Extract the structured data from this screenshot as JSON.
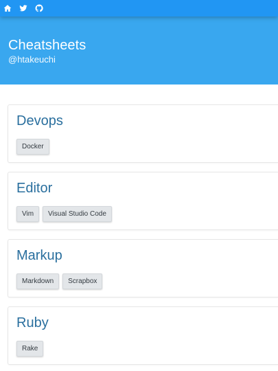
{
  "topbar": {
    "icons": [
      "home-icon",
      "twitter-icon",
      "github-icon"
    ],
    "background": "#2196f3"
  },
  "hero": {
    "title": "Cheatsheets",
    "handle": "@htakeuchi",
    "background": "#39a7ef"
  },
  "sections": [
    {
      "title": "Devops",
      "tags": [
        "Docker"
      ]
    },
    {
      "title": "Editor",
      "tags": [
        "Vim",
        "Visual Studio Code"
      ]
    },
    {
      "title": "Markup",
      "tags": [
        "Markdown",
        "Scrapbox"
      ]
    },
    {
      "title": "Ruby",
      "tags": [
        "Rake"
      ]
    }
  ],
  "colors": {
    "section_title": "#2a6f9e",
    "tag_background": "#e3e6e9"
  }
}
